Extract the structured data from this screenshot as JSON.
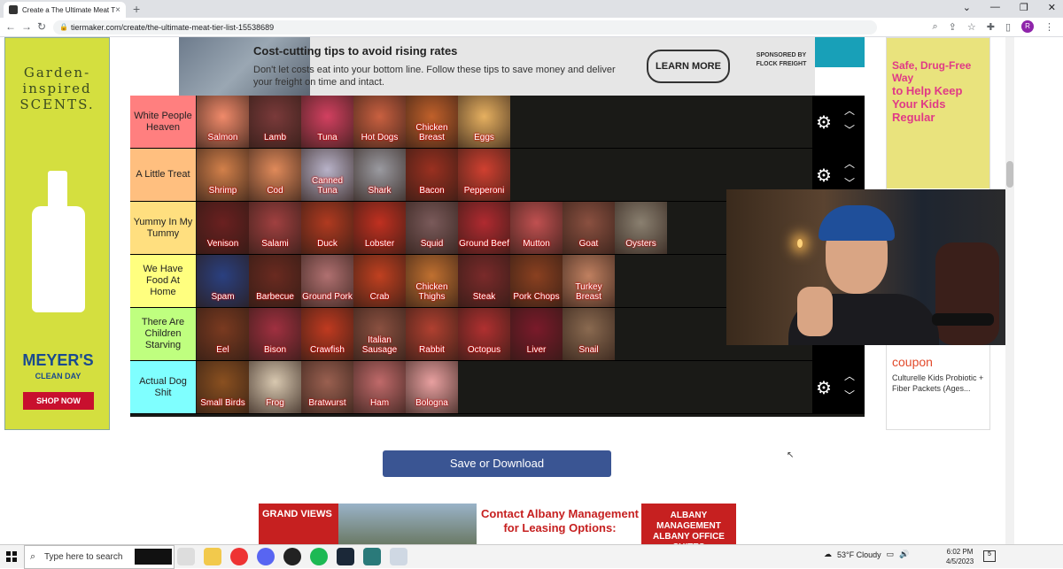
{
  "browser": {
    "tab_title": "Create a The Ultimate Meat Tier",
    "tab_close": "×",
    "new_tab": "+",
    "url": "tiermaker.com/create/the-ultimate-meat-tier-list-15538689",
    "profile_initial": "R"
  },
  "ads": {
    "left": {
      "line1": "Garden-",
      "line2": "inspired",
      "line3": "SCENTS.",
      "brand": "MEYER'S",
      "brand_sub": "CLEAN DAY",
      "cta": "SHOP NOW"
    },
    "top": {
      "headline": "Cost-cutting tips to avoid rising rates",
      "body": "Don't let costs eat into your bottom line. Follow these tips to save money and deliver your freight on time and intact.",
      "cta": "LEARN MORE",
      "sponsor": "SPONSORED BY FLOCK FREIGHT"
    },
    "right": {
      "tagline1": "Safe, Drug-Free Way",
      "tagline2": "to Help Keep Your Kids Regular",
      "coupon": "coupon",
      "desc": "Culturelle Kids Probiotic + Fiber Packets (Ages..."
    },
    "bottom": {
      "left_text": "GRAND VIEWS",
      "center_text": "Contact Albany Management for Leasing Options:",
      "logo_text": "ALBANY MANAGEMENT ALBANY OFFICE SUITES"
    }
  },
  "tiers": [
    {
      "label": "White People Heaven",
      "color": "#ff7f7f",
      "items": [
        {
          "name": "Salmon",
          "color": "#f08a6a"
        },
        {
          "name": "Lamb",
          "color": "#7a3a3a"
        },
        {
          "name": "Tuna",
          "color": "#d24060"
        },
        {
          "name": "Hot Dogs",
          "color": "#c96040"
        },
        {
          "name": "Chicken Breast",
          "color": "#c0602a"
        },
        {
          "name": "Eggs",
          "color": "#e6b060"
        }
      ]
    },
    {
      "label": "A Little Treat",
      "color": "#ffbf7f",
      "items": [
        {
          "name": "Shrimp",
          "color": "#d2804a"
        },
        {
          "name": "Cod",
          "color": "#e08a5a"
        },
        {
          "name": "Canned Tuna",
          "color": "#b8b2c8"
        },
        {
          "name": "Shark",
          "color": "#9a9aa0"
        },
        {
          "name": "Bacon",
          "color": "#9a3020"
        },
        {
          "name": "Pepperoni",
          "color": "#d04030"
        }
      ]
    },
    {
      "label": "Yummy In My Tummy",
      "color": "#ffdf7f",
      "items": [
        {
          "name": "Venison",
          "color": "#6a2020"
        },
        {
          "name": "Salami",
          "color": "#a04040"
        },
        {
          "name": "Duck",
          "color": "#b03a20"
        },
        {
          "name": "Lobster",
          "color": "#c03020"
        },
        {
          "name": "Squid",
          "color": "#7a5a5a"
        },
        {
          "name": "Ground Beef",
          "color": "#b02a30"
        },
        {
          "name": "Mutton",
          "color": "#c05050"
        },
        {
          "name": "Goat",
          "color": "#8a5040"
        },
        {
          "name": "Oysters",
          "color": "#8a8070"
        }
      ]
    },
    {
      "label": "We Have Food At Home",
      "color": "#ffff7f",
      "items": [
        {
          "name": "Spam",
          "color": "#2a4080"
        },
        {
          "name": "Barbecue",
          "color": "#6a2a20"
        },
        {
          "name": "Ground Pork",
          "color": "#b07070"
        },
        {
          "name": "Crab",
          "color": "#c04020"
        },
        {
          "name": "Chicken Thighs",
          "color": "#c07030"
        },
        {
          "name": "Steak",
          "color": "#7a2a2a"
        },
        {
          "name": "Pork Chops",
          "color": "#8a4020"
        },
        {
          "name": "Turkey Breast",
          "color": "#c08060"
        }
      ]
    },
    {
      "label": "There Are Children Starving",
      "color": "#bfff7f",
      "items": [
        {
          "name": "Eel",
          "color": "#7a3a20"
        },
        {
          "name": "Bison",
          "color": "#a03040"
        },
        {
          "name": "Crawfish",
          "color": "#c03a20"
        },
        {
          "name": "Italian Sausage",
          "color": "#8a5040"
        },
        {
          "name": "Rabbit",
          "color": "#b04030"
        },
        {
          "name": "Octopus",
          "color": "#b03030"
        },
        {
          "name": "Liver",
          "color": "#7a1a2a"
        },
        {
          "name": "Snail",
          "color": "#8a6a50"
        }
      ]
    },
    {
      "label": "Actual Dog Shit",
      "color": "#7fffff",
      "items": [
        {
          "name": "Small Birds",
          "color": "#8a5020"
        },
        {
          "name": "Frog",
          "color": "#d8c8b0"
        },
        {
          "name": "Bratwurst",
          "color": "#9a6050"
        },
        {
          "name": "Ham",
          "color": "#c06a6a"
        },
        {
          "name": "Bologna",
          "color": "#e8a0a0"
        }
      ]
    }
  ],
  "controls": {
    "gear": "⚙",
    "up": "︿",
    "down": "﹀"
  },
  "save_button": "Save or Download",
  "taskbar": {
    "search_placeholder": "Type here to search",
    "weather": "53°F  Cloudy",
    "time": "6:02 PM",
    "date": "4/5/2023",
    "notifications": "5"
  }
}
